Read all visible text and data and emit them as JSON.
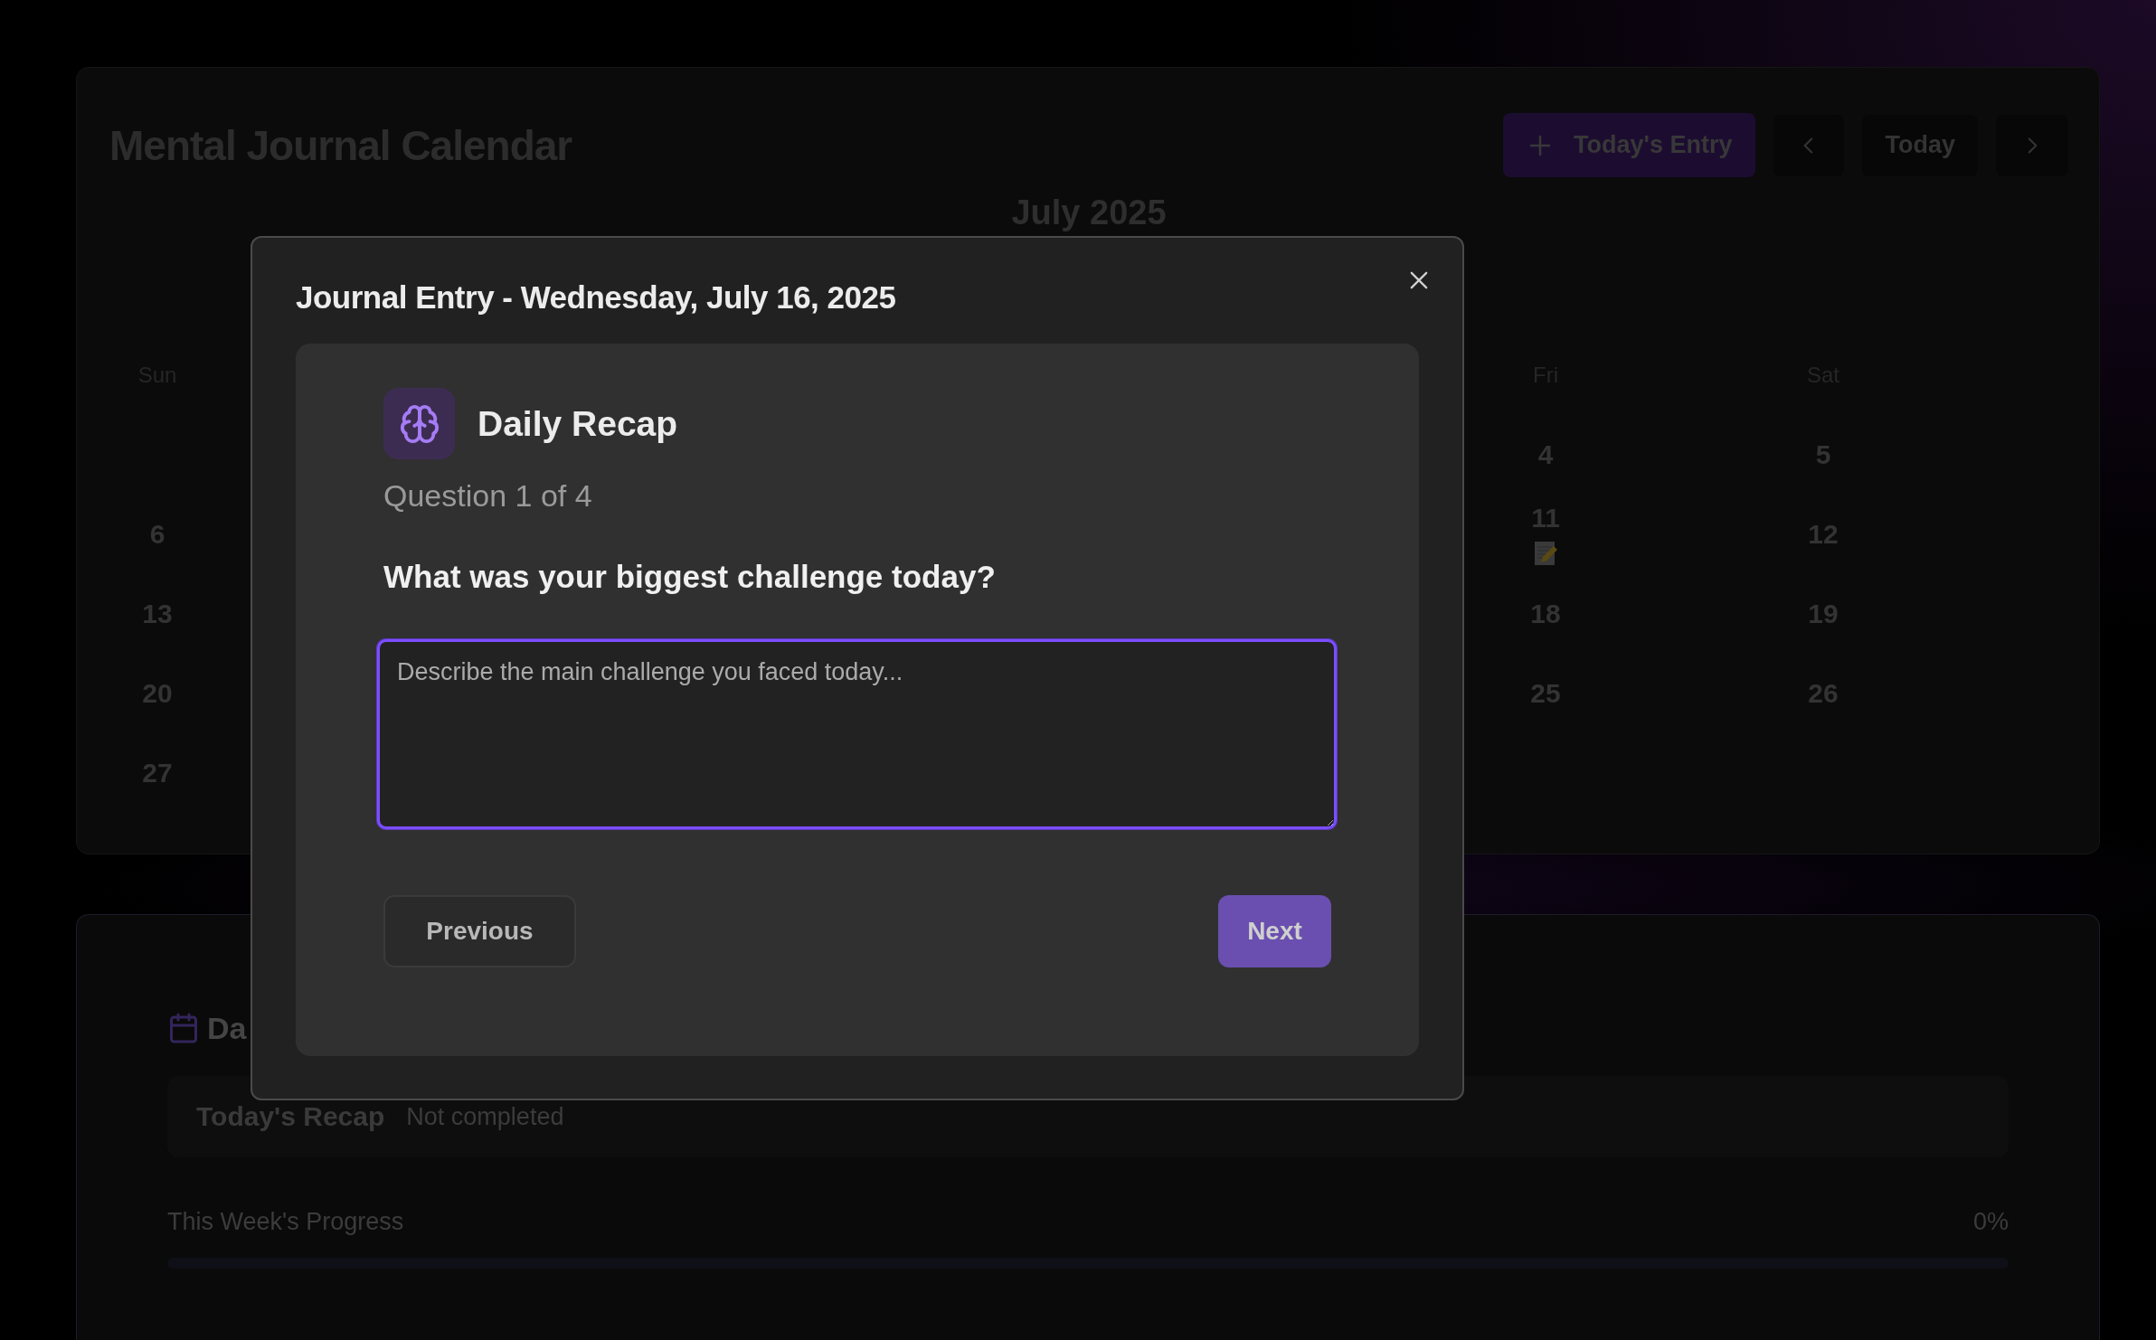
{
  "calendar": {
    "title": "Mental Journal Calendar",
    "new_entry_button": "Today's Entry",
    "today_button": "Today",
    "month": "July 2025",
    "columns": [
      {
        "weekday": "Sun",
        "cells": [
          {
            "kind": "empty"
          },
          {
            "kind": "day",
            "day": "6"
          },
          {
            "kind": "day",
            "day": "13"
          },
          {
            "kind": "day",
            "day": "20"
          },
          {
            "kind": "day",
            "day": "27"
          }
        ]
      },
      {
        "weekday": "Fri",
        "cells": [
          {
            "kind": "day",
            "day": "4"
          },
          {
            "kind": "entry",
            "day": "11"
          },
          {
            "kind": "day",
            "day": "18"
          },
          {
            "kind": "day",
            "day": "25"
          }
        ]
      },
      {
        "weekday": "Sat",
        "cells": [
          {
            "kind": "day",
            "day": "5"
          },
          {
            "kind": "day",
            "day": "12"
          },
          {
            "kind": "day",
            "day": "19"
          },
          {
            "kind": "day",
            "day": "26"
          }
        ]
      }
    ]
  },
  "dashboard": {
    "title": "Da",
    "recap": {
      "label": "Today's Recap",
      "status": "Not completed"
    },
    "progress": {
      "label": "This Week's Progress",
      "value": "0%",
      "level": 0
    }
  },
  "modal": {
    "title": "Journal Entry - Wednesday, July 16, 2025",
    "section": "Daily Recap",
    "counter": "Question 1 of 4",
    "question": "What was your biggest challenge today?",
    "answer": {
      "placeholder": "Describe the main challenge you faced today...",
      "focused": true
    },
    "buttons": {
      "previous": "Previous",
      "next": "Next"
    }
  }
}
